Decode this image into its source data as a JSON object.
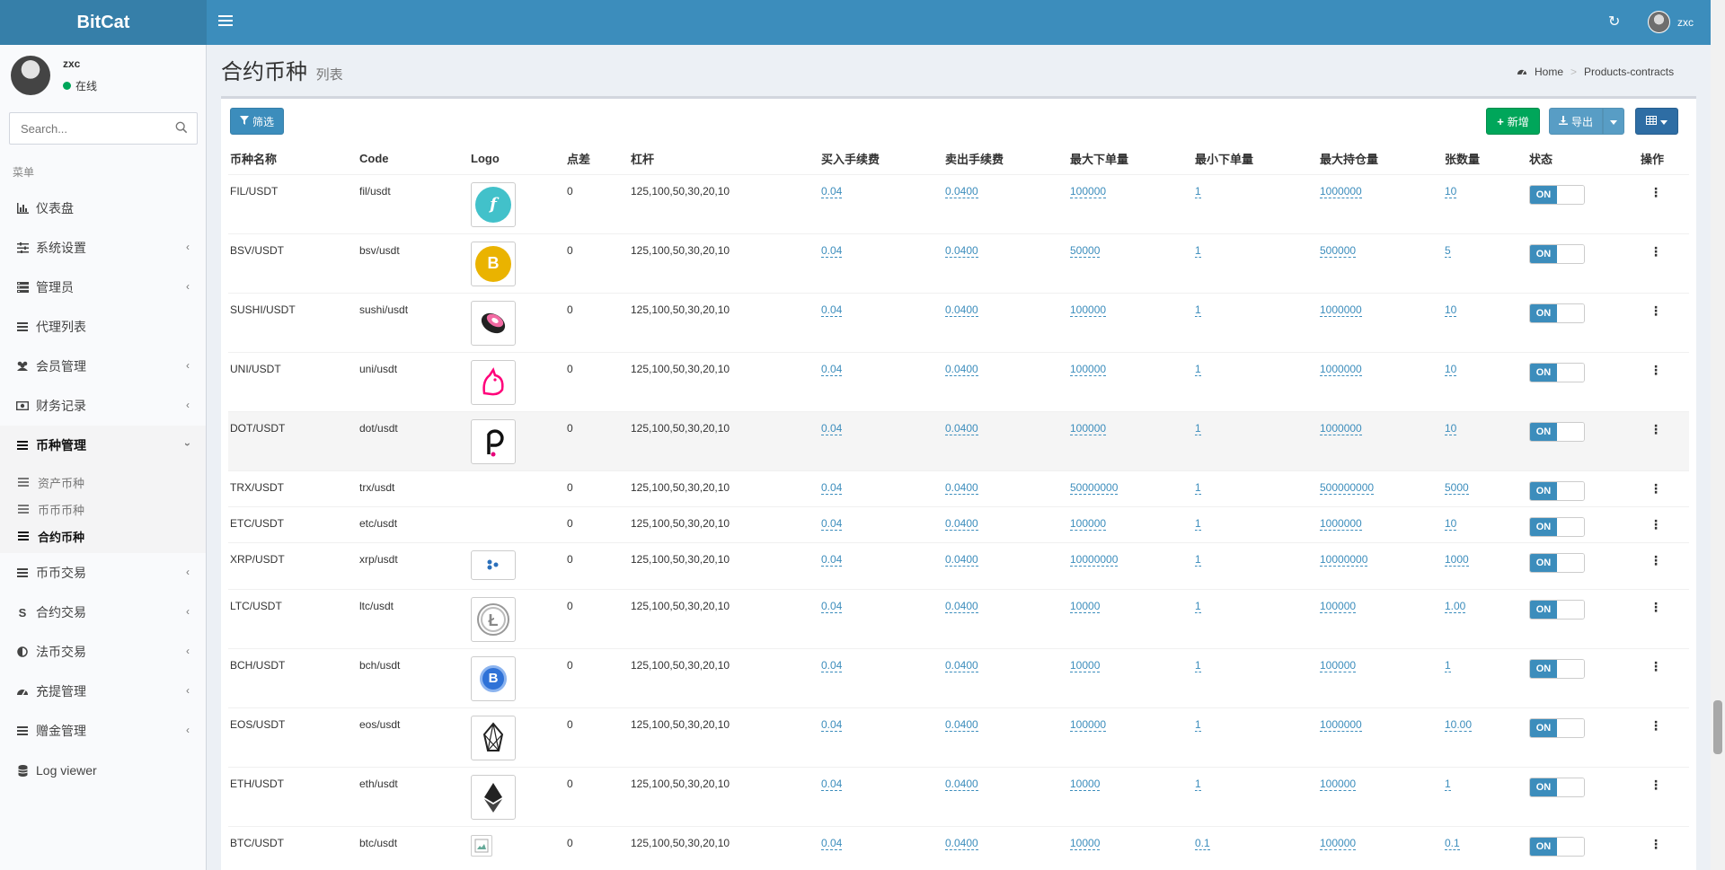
{
  "app": {
    "brand": "BitCat"
  },
  "header": {
    "username": "zxc"
  },
  "sidebar": {
    "user": {
      "name": "zxc",
      "status": "在线"
    },
    "search_placeholder": "Search...",
    "menu_header": "菜单",
    "items": [
      {
        "label": "仪表盘",
        "icon": "dashboard-icon"
      },
      {
        "label": "系统设置",
        "icon": "sliders-icon"
      },
      {
        "label": "管理员",
        "icon": "admin-icon"
      },
      {
        "label": "代理列表",
        "icon": "list-icon"
      },
      {
        "label": "会员管理",
        "icon": "users-icon"
      },
      {
        "label": "财务记录",
        "icon": "money-icon"
      },
      {
        "label": "币种管理",
        "icon": "list-icon"
      },
      {
        "label": "币币交易",
        "icon": "list-icon"
      },
      {
        "label": "合约交易",
        "icon": "strike-icon"
      },
      {
        "label": "法币交易",
        "icon": "half-circle-icon"
      },
      {
        "label": "充提管理",
        "icon": "gauge-icon"
      },
      {
        "label": "赠金管理",
        "icon": "list-icon"
      },
      {
        "label": "Log viewer",
        "icon": "database-icon"
      }
    ],
    "sub_items": [
      {
        "label": "资产币种"
      },
      {
        "label": "币币币种"
      },
      {
        "label": "合约币种"
      }
    ]
  },
  "page": {
    "title": "合约币种",
    "subtitle": "列表"
  },
  "breadcrumb": {
    "home": "Home",
    "current": "Products-contracts"
  },
  "toolbar": {
    "filter": "筛选",
    "add": "新增",
    "export": "导出"
  },
  "table": {
    "headers": [
      "币种名称",
      "Code",
      "Logo",
      "点差",
      "杠杆",
      "买入手续费",
      "卖出手续费",
      "最大下单量",
      "最小下单量",
      "最大持仓量",
      "张数量",
      "状态",
      "操作"
    ],
    "toggle_label": "ON",
    "rows": [
      {
        "name": "FIL/USDT",
        "code": "fil/usdt",
        "logo": "fil-coin-icon",
        "spread": "0",
        "leverage": "125,100,50,30,20,10",
        "buy_fee": "0.04",
        "sell_fee": "0.0400",
        "max_order": "100000",
        "min_order": "1",
        "max_position": "1000000",
        "lot": "10"
      },
      {
        "name": "BSV/USDT",
        "code": "bsv/usdt",
        "logo": "bsv-coin-icon",
        "spread": "0",
        "leverage": "125,100,50,30,20,10",
        "buy_fee": "0.04",
        "sell_fee": "0.0400",
        "max_order": "50000",
        "min_order": "1",
        "max_position": "500000",
        "lot": "5"
      },
      {
        "name": "SUSHI/USDT",
        "code": "sushi/usdt",
        "logo": "sushi-coin-icon",
        "spread": "0",
        "leverage": "125,100,50,30,20,10",
        "buy_fee": "0.04",
        "sell_fee": "0.0400",
        "max_order": "100000",
        "min_order": "1",
        "max_position": "1000000",
        "lot": "10"
      },
      {
        "name": "UNI/USDT",
        "code": "uni/usdt",
        "logo": "uni-coin-icon",
        "spread": "0",
        "leverage": "125,100,50,30,20,10",
        "buy_fee": "0.04",
        "sell_fee": "0.0400",
        "max_order": "100000",
        "min_order": "1",
        "max_position": "1000000",
        "lot": "10"
      },
      {
        "name": "DOT/USDT",
        "code": "dot/usdt",
        "logo": "dot-coin-icon",
        "spread": "0",
        "leverage": "125,100,50,30,20,10",
        "buy_fee": "0.04",
        "sell_fee": "0.0400",
        "max_order": "100000",
        "min_order": "1",
        "max_position": "1000000",
        "lot": "10"
      },
      {
        "name": "TRX/USDT",
        "code": "trx/usdt",
        "logo": "",
        "spread": "0",
        "leverage": "125,100,50,30,20,10",
        "buy_fee": "0.04",
        "sell_fee": "0.0400",
        "max_order": "50000000",
        "min_order": "1",
        "max_position": "500000000",
        "lot": "5000"
      },
      {
        "name": "ETC/USDT",
        "code": "etc/usdt",
        "logo": "",
        "spread": "0",
        "leverage": "125,100,50,30,20,10",
        "buy_fee": "0.04",
        "sell_fee": "0.0400",
        "max_order": "100000",
        "min_order": "1",
        "max_position": "1000000",
        "lot": "10"
      },
      {
        "name": "XRP/USDT",
        "code": "xrp/usdt",
        "logo": "xrp-coin-icon",
        "spread": "0",
        "leverage": "125,100,50,30,20,10",
        "buy_fee": "0.04",
        "sell_fee": "0.0400",
        "max_order": "10000000",
        "min_order": "1",
        "max_position": "10000000",
        "lot": "1000"
      },
      {
        "name": "LTC/USDT",
        "code": "ltc/usdt",
        "logo": "ltc-coin-icon",
        "spread": "0",
        "leverage": "125,100,50,30,20,10",
        "buy_fee": "0.04",
        "sell_fee": "0.0400",
        "max_order": "10000",
        "min_order": "1",
        "max_position": "100000",
        "lot": "1.00"
      },
      {
        "name": "BCH/USDT",
        "code": "bch/usdt",
        "logo": "bch-coin-icon",
        "spread": "0",
        "leverage": "125,100,50,30,20,10",
        "buy_fee": "0.04",
        "sell_fee": "0.0400",
        "max_order": "10000",
        "min_order": "1",
        "max_position": "100000",
        "lot": "1"
      },
      {
        "name": "EOS/USDT",
        "code": "eos/usdt",
        "logo": "eos-coin-icon",
        "spread": "0",
        "leverage": "125,100,50,30,20,10",
        "buy_fee": "0.04",
        "sell_fee": "0.0400",
        "max_order": "100000",
        "min_order": "1",
        "max_position": "1000000",
        "lot": "10.00"
      },
      {
        "name": "ETH/USDT",
        "code": "eth/usdt",
        "logo": "eth-coin-icon",
        "spread": "0",
        "leverage": "125,100,50,30,20,10",
        "buy_fee": "0.04",
        "sell_fee": "0.0400",
        "max_order": "10000",
        "min_order": "1",
        "max_position": "100000",
        "lot": "1"
      },
      {
        "name": "BTC/USDT",
        "code": "btc/usdt",
        "logo": "broken-image-icon",
        "spread": "0",
        "leverage": "125,100,50,30,20,10",
        "buy_fee": "0.04",
        "sell_fee": "0.0400",
        "max_order": "10000",
        "min_order": "0.1",
        "max_position": "100000",
        "lot": "0.1"
      }
    ]
  },
  "colors": {
    "header": "#3c8dbc",
    "logo_bg": "#367fa9",
    "success": "#00a65a",
    "link": "#3c8dbc"
  }
}
